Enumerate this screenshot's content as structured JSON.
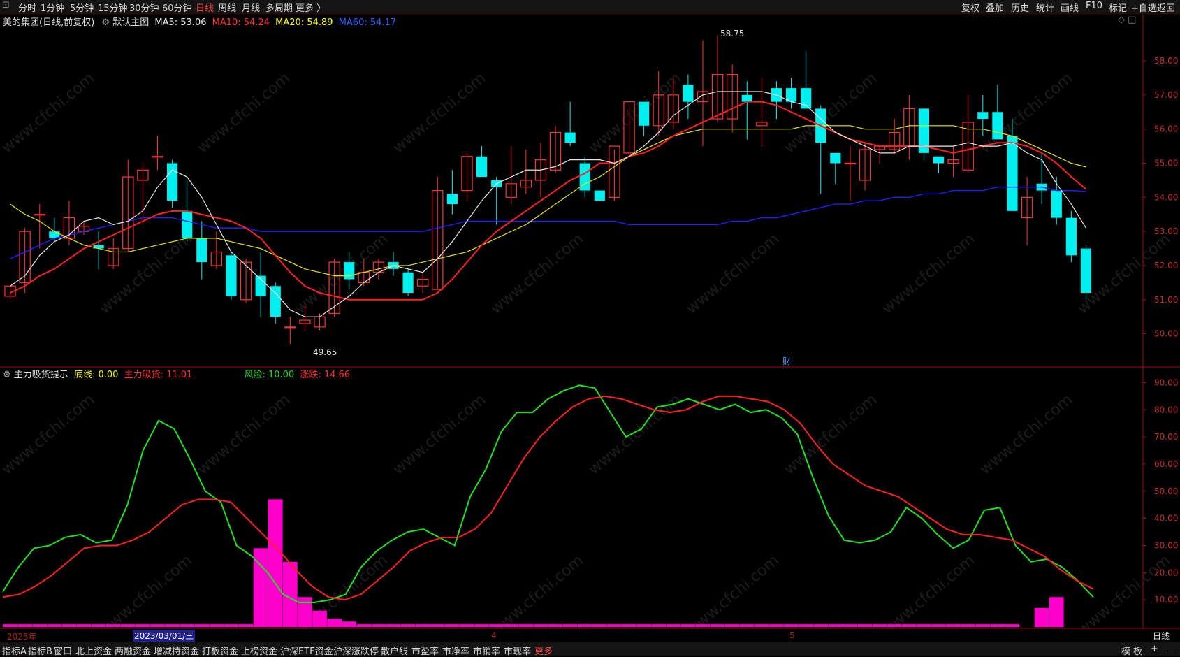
{
  "toolbar": {
    "periods": [
      "分时",
      "1分钟",
      "5分钟",
      "15分钟",
      "30分钟",
      "60分钟",
      "日线",
      "周线",
      "月线",
      "多周期",
      "更多 〉"
    ],
    "active_period": "日线",
    "right_items": [
      "复权",
      "叠加",
      "历史",
      "统计",
      "画线",
      "F10",
      "标记",
      "+自选",
      "返回"
    ]
  },
  "main_legend": {
    "stock_name": "美的集团(日线,前复权)",
    "template": "默认主图",
    "ma5": "MA5: 53.06",
    "ma10": "MA10: 54.24",
    "ma20": "MA20: 54.89",
    "ma60": "MA60: 54.17"
  },
  "sub_legend": {
    "indicator": "主力吸货提示",
    "base_line": "底线: 0.00",
    "main_absorb": "主力吸货: 11.01",
    "risk": "风险: 10.00",
    "rise_fall": "涨跌: 14.66"
  },
  "colors": {
    "up": "#ff3333",
    "down": "#00f0f0",
    "ma5": "#e8e8e8",
    "ma10": "#ff2020",
    "ma20": "#e8e800",
    "ma60": "#2020ff",
    "risk": "#20e020",
    "absorb_line": "#ff2020",
    "absorb_bar": "#ff00cc",
    "grid_axis": "#aa0000"
  },
  "annotations": {
    "high_label": "58.75",
    "low_label": "49.65",
    "cai_label": "财"
  },
  "date_axis": {
    "year_label": "2023年",
    "cursor_date": "2023/03/01/三",
    "month4": "4",
    "month5": "5",
    "period_box": "日线"
  },
  "bottom_tabs": [
    "指标A",
    "指标B",
    "窗口",
    "北上资金",
    "两融资金",
    "增减持资金",
    "打板资金",
    "上榜资金",
    "沪深ETF资金",
    "沪深涨跌停",
    "散户线",
    "市盈率",
    "市净率",
    "市销率",
    "市现率",
    "更多"
  ],
  "bottom_right": [
    "模",
    "板",
    "+",
    "—"
  ],
  "chart_data": [
    {
      "type": "candlestick",
      "title": "美的集团(日线,前复权)",
      "ylim": [
        49.5,
        58.8
      ],
      "y_ticks": [
        "58.00",
        "57.00",
        "56.00",
        "55.00",
        "54.00",
        "53.00",
        "52.00",
        "51.00",
        "50.00"
      ],
      "y_tick_values": [
        58,
        57,
        56,
        55,
        54,
        53,
        52,
        51,
        50
      ],
      "candles": [
        [
          51.1,
          51.4,
          51.0,
          51.4
        ],
        [
          51.5,
          53.1,
          51.2,
          53.0
        ],
        [
          53.5,
          53.8,
          52.5,
          53.5
        ],
        [
          53.0,
          53.4,
          52.7,
          52.8
        ],
        [
          52.8,
          53.9,
          52.6,
          53.4
        ],
        [
          53.0,
          53.3,
          52.9,
          53.15
        ],
        [
          52.6,
          53.0,
          51.9,
          52.5
        ],
        [
          52.0,
          52.8,
          51.9,
          52.5
        ],
        [
          52.5,
          55.1,
          52.4,
          54.6
        ],
        [
          54.5,
          55.0,
          53.2,
          54.8
        ],
        [
          55.2,
          55.8,
          54.8,
          55.2
        ],
        [
          55.0,
          55.1,
          53.7,
          53.9
        ],
        [
          53.6,
          54.5,
          52.7,
          52.8
        ],
        [
          52.8,
          53.3,
          51.6,
          52.1
        ],
        [
          52.0,
          53.0,
          51.9,
          52.4
        ],
        [
          52.3,
          52.4,
          51.0,
          51.1
        ],
        [
          51.0,
          52.2,
          50.9,
          52.1
        ],
        [
          51.7,
          52.4,
          50.5,
          51.1
        ],
        [
          51.4,
          51.5,
          50.3,
          50.5
        ],
        [
          50.2,
          50.5,
          49.7,
          50.2
        ],
        [
          50.3,
          50.8,
          50.1,
          50.4
        ],
        [
          50.2,
          50.6,
          50.1,
          50.5
        ],
        [
          50.6,
          52.2,
          50.5,
          52.1
        ],
        [
          52.1,
          52.4,
          51.3,
          51.6
        ],
        [
          51.5,
          52.2,
          51.4,
          51.8
        ],
        [
          51.8,
          52.2,
          51.6,
          52.1
        ],
        [
          52.1,
          52.4,
          51.7,
          51.9
        ],
        [
          51.8,
          51.9,
          51.1,
          51.2
        ],
        [
          51.4,
          51.8,
          51.2,
          51.6
        ],
        [
          51.3,
          54.6,
          51.3,
          54.2
        ],
        [
          54.1,
          54.8,
          53.5,
          53.8
        ],
        [
          54.2,
          55.3,
          53.9,
          55.2
        ],
        [
          55.2,
          55.5,
          54.6,
          54.6
        ],
        [
          54.5,
          54.6,
          53.2,
          54.3
        ],
        [
          54.0,
          55.5,
          53.8,
          54.4
        ],
        [
          54.3,
          55.4,
          54.1,
          54.5
        ],
        [
          54.5,
          55.6,
          54.0,
          55.1
        ],
        [
          54.8,
          56.1,
          54.7,
          55.9
        ],
        [
          55.9,
          56.8,
          55.5,
          55.6
        ],
        [
          55.0,
          55.2,
          54.0,
          54.2
        ],
        [
          54.2,
          54.2,
          53.9,
          53.9
        ],
        [
          54.0,
          55.4,
          53.9,
          55.5
        ],
        [
          55.3,
          56.7,
          55.2,
          56.8
        ],
        [
          56.8,
          56.8,
          55.8,
          56.1
        ],
        [
          56.1,
          57.7,
          55.8,
          57.0
        ],
        [
          56.2,
          57.5,
          56.0,
          57.0
        ],
        [
          57.3,
          57.6,
          56.3,
          56.8
        ],
        [
          56.8,
          58.6,
          55.5,
          57.1
        ],
        [
          56.3,
          58.75,
          56.2,
          57.6
        ],
        [
          56.3,
          57.9,
          55.9,
          57.6
        ],
        [
          57.0,
          57.4,
          55.7,
          56.8
        ],
        [
          56.1,
          57.5,
          55.5,
          56.2
        ],
        [
          57.2,
          57.4,
          56.3,
          56.8
        ],
        [
          57.2,
          57.5,
          56.6,
          56.8
        ],
        [
          57.2,
          58.3,
          56.6,
          56.6
        ],
        [
          56.6,
          56.7,
          54.1,
          55.6
        ],
        [
          55.3,
          55.3,
          54.4,
          55.0
        ],
        [
          55.0,
          55.5,
          53.9,
          55.0
        ],
        [
          54.5,
          55.6,
          54.2,
          55.4
        ],
        [
          55.4,
          55.5,
          55.0,
          55.5
        ],
        [
          55.4,
          56.3,
          55.3,
          55.9
        ],
        [
          55.5,
          57.0,
          55.1,
          56.6
        ],
        [
          56.6,
          56.6,
          55.1,
          55.3
        ],
        [
          55.2,
          55.1,
          54.7,
          55.0
        ],
        [
          55.0,
          55.5,
          54.6,
          55.1
        ],
        [
          54.8,
          57.0,
          54.7,
          56.2
        ],
        [
          56.5,
          57.0,
          55.8,
          56.3
        ],
        [
          56.5,
          57.3,
          55.8,
          55.7
        ],
        [
          55.8,
          56.3,
          53.6,
          53.6
        ],
        [
          53.4,
          54.6,
          52.6,
          54.0
        ],
        [
          54.4,
          55.3,
          53.8,
          54.2
        ],
        [
          54.2,
          54.6,
          53.2,
          53.4
        ],
        [
          53.4,
          53.6,
          52.1,
          52.3
        ],
        [
          52.5,
          52.6,
          51.0,
          51.2
        ]
      ],
      "ma5": [
        51.4,
        51.7,
        52.3,
        52.7,
        52.9,
        53.3,
        53.4,
        53.2,
        53.3,
        53.6,
        54.3,
        54.8,
        54.6,
        54.0,
        53.2,
        52.4,
        52.0,
        51.6,
        51.2,
        50.7,
        50.5,
        50.5,
        50.8,
        51.1,
        51.5,
        51.8,
        52.0,
        51.9,
        51.8,
        52.2,
        52.7,
        53.3,
        53.9,
        54.4,
        54.6,
        54.8,
        54.8,
        54.9,
        55.1,
        55.1,
        55.1,
        55.0,
        55.2,
        55.5,
        55.9,
        56.4,
        56.7,
        57.0,
        57.1,
        57.1,
        57.1,
        57.1,
        57.0,
        56.8,
        56.7,
        56.3,
        55.9,
        55.7,
        55.5,
        55.3,
        55.3,
        55.5,
        55.5,
        55.5,
        55.5,
        55.6,
        55.5,
        55.5,
        55.6,
        55.3,
        55.1,
        54.4,
        53.8,
        53.1
      ],
      "ma10": [
        51.2,
        51.4,
        51.7,
        51.9,
        52.2,
        52.5,
        52.7,
        52.9,
        53.1,
        53.3,
        53.5,
        53.6,
        53.6,
        53.5,
        53.4,
        53.3,
        53.1,
        52.8,
        52.3,
        51.8,
        51.4,
        51.2,
        51.1,
        51.0,
        51.0,
        51.0,
        51.0,
        51.0,
        51.0,
        51.2,
        51.6,
        52.1,
        52.6,
        53.0,
        53.3,
        53.6,
        53.9,
        54.2,
        54.5,
        54.7,
        55.0,
        55.0,
        55.2,
        55.3,
        55.5,
        55.8,
        56.0,
        56.2,
        56.4,
        56.6,
        56.8,
        56.8,
        56.7,
        56.5,
        56.3,
        56.1,
        55.9,
        55.7,
        55.6,
        55.5,
        55.5,
        55.5,
        55.5,
        55.4,
        55.3,
        55.4,
        55.5,
        55.6,
        55.6,
        55.5,
        55.3,
        55.0,
        54.6,
        54.24
      ],
      "ma20": [
        53.8,
        53.5,
        53.3,
        53.0,
        52.8,
        52.6,
        52.5,
        52.4,
        52.4,
        52.5,
        52.6,
        52.7,
        52.8,
        52.8,
        52.8,
        52.7,
        52.6,
        52.5,
        52.3,
        52.1,
        51.9,
        51.8,
        51.7,
        51.7,
        51.8,
        51.9,
        52.0,
        52.0,
        52.1,
        52.2,
        52.3,
        52.4,
        52.6,
        52.8,
        53.0,
        53.2,
        53.5,
        53.8,
        54.1,
        54.4,
        54.6,
        54.9,
        55.2,
        55.4,
        55.6,
        55.8,
        55.9,
        56.0,
        56.0,
        56.0,
        56.0,
        56.0,
        56.0,
        56.0,
        56.1,
        56.1,
        56.1,
        56.1,
        56.0,
        56.0,
        56.0,
        56.1,
        56.1,
        56.1,
        56.1,
        56.0,
        56.0,
        55.9,
        55.8,
        55.6,
        55.4,
        55.2,
        55.0,
        54.89
      ],
      "ma60": [
        52.2,
        52.4,
        52.6,
        52.8,
        52.9,
        53.0,
        53.1,
        53.2,
        53.3,
        53.4,
        53.4,
        53.4,
        53.3,
        53.2,
        53.1,
        53.1,
        53.1,
        53.0,
        53.0,
        53.0,
        53.0,
        53.0,
        53.0,
        53.0,
        53.0,
        53.0,
        53.0,
        53.0,
        53.0,
        53.1,
        53.2,
        53.3,
        53.3,
        53.3,
        53.3,
        53.3,
        53.3,
        53.3,
        53.3,
        53.3,
        53.3,
        53.3,
        53.2,
        53.2,
        53.2,
        53.2,
        53.2,
        53.2,
        53.2,
        53.3,
        53.3,
        53.4,
        53.4,
        53.5,
        53.6,
        53.7,
        53.8,
        53.8,
        53.9,
        53.9,
        54.0,
        54.0,
        54.1,
        54.1,
        54.2,
        54.2,
        54.2,
        54.3,
        54.3,
        54.3,
        54.3,
        54.2,
        54.2,
        54.17
      ]
    },
    {
      "type": "line",
      "title": "主力吸货提示",
      "ylim": [
        0,
        95
      ],
      "y_ticks": [
        "90.00",
        "80.00",
        "70.00",
        "60.00",
        "50.00",
        "40.00",
        "30.00",
        "20.00",
        "10.00"
      ],
      "y_tick_values": [
        90,
        80,
        70,
        60,
        50,
        40,
        30,
        20,
        10
      ],
      "series": [
        {
          "name": "风险",
          "values": [
            13,
            22,
            29,
            30,
            33,
            34,
            31,
            32,
            45,
            65,
            76,
            73,
            62,
            50,
            46,
            30,
            26,
            20,
            12,
            9,
            9,
            10,
            12,
            22,
            28,
            32,
            35,
            36,
            33,
            30,
            48,
            58,
            72,
            79,
            79,
            84,
            87,
            89,
            88,
            79,
            70,
            73,
            81,
            82,
            84,
            82,
            80,
            82,
            79,
            80,
            77,
            71,
            55,
            41,
            32,
            31,
            32,
            35,
            44,
            40,
            34,
            29,
            32,
            43,
            44,
            30,
            24,
            25,
            22,
            17,
            11
          ]
        },
        {
          "name": "主力吸货",
          "values": [
            11,
            12,
            15,
            19,
            24,
            29,
            30,
            30,
            32,
            35,
            40,
            45,
            47,
            47,
            46,
            40,
            34,
            28,
            21,
            15,
            11,
            10,
            12,
            17,
            22,
            28,
            31,
            33,
            33,
            36,
            42,
            52,
            62,
            70,
            76,
            81,
            84,
            85,
            84,
            82,
            80,
            79,
            80,
            83,
            85,
            85,
            84,
            83,
            80,
            75,
            67,
            60,
            56,
            52,
            50,
            48,
            44,
            40,
            36,
            34,
            34,
            33,
            32,
            29,
            26,
            21,
            17,
            14
          ]
        },
        {
          "name": "主力吸货柱",
          "values": [
            1,
            1,
            1,
            1,
            1,
            1,
            1,
            1,
            1,
            1,
            1,
            1,
            1,
            1,
            1,
            1,
            1,
            29,
            47,
            24,
            11,
            6,
            3,
            2,
            1,
            1,
            1,
            1,
            1,
            1,
            1,
            1,
            1,
            1,
            1,
            1,
            1,
            1,
            1,
            1,
            1,
            1,
            1,
            1,
            1,
            1,
            1,
            1,
            1,
            1,
            1,
            1,
            1,
            1,
            1,
            1,
            1,
            1,
            1,
            1,
            1,
            1,
            1,
            1,
            1,
            1,
            1,
            1,
            1,
            0,
            7,
            11
          ]
        }
      ]
    }
  ]
}
